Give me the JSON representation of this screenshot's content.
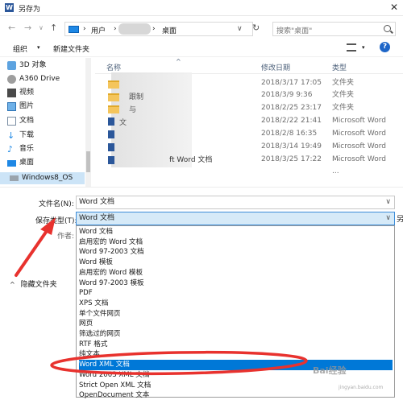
{
  "window": {
    "title": "另存为",
    "app_icon": "W",
    "close": "✕"
  },
  "nav": {
    "back": "←",
    "forward": "→",
    "up_history": "∨",
    "up": "↑",
    "path_user": "用户",
    "path_sep1": "›",
    "path_sep2": "›",
    "path_desktop": "桌面",
    "chevron": "∨",
    "refresh": "↻",
    "search_placeholder": "搜索\"桌面\""
  },
  "toolbar": {
    "organize": "组织",
    "new_folder": "新建文件夹",
    "view_chevron": "▾",
    "help": "?"
  },
  "sidebar": {
    "items": [
      {
        "label": "3D 对象",
        "icon": "cube-icon"
      },
      {
        "label": "A360 Drive",
        "icon": "cloud-icon"
      },
      {
        "label": "视频",
        "icon": "video-icon"
      },
      {
        "label": "图片",
        "icon": "picture-icon"
      },
      {
        "label": "文档",
        "icon": "document-icon"
      },
      {
        "label": "下载",
        "icon": "download-icon"
      },
      {
        "label": "音乐",
        "icon": "music-icon"
      },
      {
        "label": "桌面",
        "icon": "desktop-icon"
      },
      {
        "label": "Windows8_OS",
        "icon": "drive-icon"
      }
    ]
  },
  "files": {
    "columns": {
      "name": "名称",
      "modified": "修改日期",
      "type": "类型"
    },
    "rows": [
      {
        "date": "2018/3/17 17:05",
        "type": "文件夹"
      },
      {
        "date": "2018/3/9 9:36",
        "type": "文件夹"
      },
      {
        "date": "2018/2/25 23:17",
        "type": "文件夹"
      },
      {
        "date": "2018/2/22 21:41",
        "type": "Microsoft Word ..."
      },
      {
        "date": "2018/2/8 16:35",
        "type": "Microsoft Word ..."
      },
      {
        "date": "2018/3/14 19:49",
        "type": "Microsoft Word ..."
      },
      {
        "date": "2018/3/25 17:22",
        "type": "Microsoft Word ..."
      }
    ],
    "partial_names": {
      "row2": "跟制",
      "row3": "与",
      "last": "ft Word 文档",
      "partial4": "文"
    }
  },
  "form": {
    "filename_label": "文件名(N):",
    "filename_value": "Word 文档",
    "filetype_label": "保存类型(T):",
    "filetype_value": "Word 文档",
    "author_label": "作者:",
    "cut_right": "另",
    "hide_folders": "隐藏文件夹",
    "chevron": "∨"
  },
  "dropdown_options": [
    "Word 文档",
    "启用宏的 Word 文档",
    "Word 97-2003 文档",
    "Word 模板",
    "启用宏的 Word 模板",
    "Word 97-2003 模板",
    "PDF",
    "XPS 文档",
    "单个文件网页",
    "网页",
    "筛选过的网页",
    "RTF 格式",
    "纯文本",
    "Word XML 文档",
    "Word 2003 XML 文档",
    "Strict Open XML 文档",
    "OpenDocument 文本"
  ],
  "selected_option_index": 13,
  "watermark": {
    "main": "Bai经验",
    "sub": "jingyan.baidu.com"
  },
  "colors": {
    "accent": "#0078d7",
    "annotation": "#e8322e",
    "selection": "#cce4f7"
  }
}
